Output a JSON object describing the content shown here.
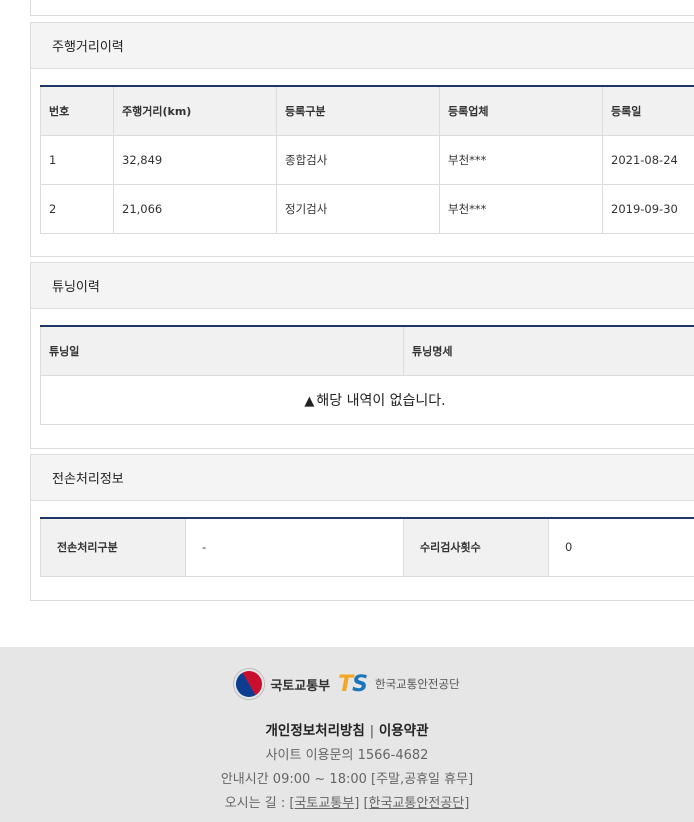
{
  "mileage": {
    "title": "주행거리이력",
    "headers": [
      "번호",
      "주행거리(km)",
      "등록구분",
      "등록업체",
      "등록일"
    ],
    "rows": [
      [
        "1",
        "32,849",
        "종합검사",
        "부천***",
        "2021-08-24"
      ],
      [
        "2",
        "21,066",
        "정기검사",
        "부천***",
        "2019-09-30"
      ]
    ]
  },
  "tuning": {
    "title": "튜닝이력",
    "headers": [
      "튜닝일",
      "튜닝명세"
    ],
    "empty_icon": "warning-icon",
    "empty_text": "해당 내역이 없습니다."
  },
  "total_loss": {
    "title": "전손처리정보",
    "type_label": "전손처리구분",
    "type_value": "-",
    "repair_label": "수리검사횟수",
    "repair_value": "0"
  },
  "footer": {
    "ministry": "국토교통부",
    "ts_logo_t": "T",
    "ts_logo_s": "S",
    "agency": "한국교통안전공단",
    "privacy": "개인정보처리방침",
    "separator": "|",
    "terms": "이용약관",
    "inquiry": "사이트 이용문의 1566-4682",
    "hours": "안내시간 09:00 ~ 18:00 [주말,공휴일 휴무]",
    "directions_label": "오시는 길 :",
    "directions_link1": "[국토교통부]",
    "directions_link2": "[한국교통안전공단]"
  },
  "colors": {
    "header_rule": "#1f3864",
    "panel_border": "#dcdcdc",
    "ts_orange": "#f5a623",
    "ts_blue": "#1b75bb"
  }
}
